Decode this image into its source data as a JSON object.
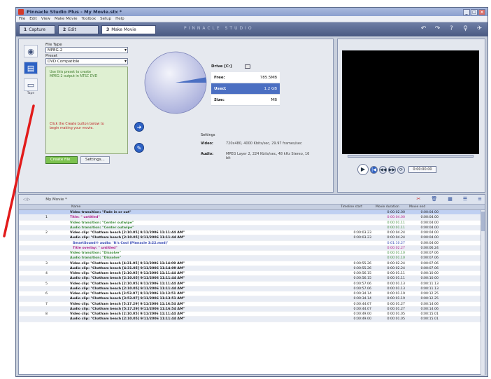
{
  "app": {
    "title": "Pinnacle Studio Plus - My Movie.stx *"
  },
  "menu": [
    "File",
    "Edit",
    "View",
    "Make Movie",
    "Toolbox",
    "Setup",
    "Help"
  ],
  "tabs": [
    {
      "num": "1",
      "label": "Capture"
    },
    {
      "num": "2",
      "label": "Edit"
    },
    {
      "num": "3",
      "label": "Make Movie"
    }
  ],
  "brand": "PINNACLE   STUDIO",
  "left_tools": {
    "disc": "disc-icon",
    "file": "file-icon",
    "tape": "tape-icon",
    "tape_label": "Tape"
  },
  "options": {
    "file_type_label": "File Type",
    "file_type_value": "MPEG-2",
    "preset_label": "Preset",
    "preset_value": "DVD Compatible",
    "tip": "Use this preset to create MPEG-2 output in NTSC DVD",
    "note": "Click the Create button below to begin making your movie.",
    "create_label": "Create file",
    "settings_label": "Settings..."
  },
  "drive": {
    "title": "Drive [C:]",
    "free_label": "Free:",
    "free_value": "785.5MB",
    "used_label": "Used:",
    "used_value": "1.2 GB",
    "size_label": "Size:",
    "size_value": "MB"
  },
  "settings": {
    "head": "Settings",
    "video_label": "Video:",
    "video_value": "720x480, 4000 Kbits/sec, 29.97 frames/sec",
    "audio_label": "Audio:",
    "audio_value": "MPEG Layer 2, 224 Kbits/sec, 48 kHz Stereo, 16 bit"
  },
  "preview": {
    "counter": "0:00:00.00"
  },
  "list": {
    "movie_label": "My Movie *",
    "headers": [
      "Name",
      "Timeline start",
      "Movie duration",
      "Movie end"
    ],
    "rows": [
      {
        "num": "",
        "name": "Video transition: \"Fade in or out\"",
        "start": "",
        "dur": "0:00:02.00",
        "end": "0:00:04.00",
        "style": "sel"
      },
      {
        "num": "1",
        "name": "Title: \" untitled\"",
        "start": "",
        "dur": "0:00:04.00",
        "end": "0:00:04.00",
        "style": "pink"
      },
      {
        "num": "",
        "name": "Video transition: \"Center outwipe\"",
        "start": "",
        "dur": "0:00:01.11",
        "end": "0:00:04.00",
        "style": "green"
      },
      {
        "num": "",
        "name": "Audio transition: \"Center outwipe\"",
        "start": "",
        "dur": "0:00:01.11",
        "end": "0:00:04.00",
        "style": "green"
      },
      {
        "num": "2",
        "name": "Video clip: \"Chatham beach [2:10.05]  9/11/2006 11:11:44 AM\"",
        "start": "0:00:03.23",
        "dur": "0:00:04.24",
        "end": "0:00:04.00",
        "style": ""
      },
      {
        "num": "",
        "name": "Audio clip: \"Chatham beach [2:10.05]  9/11/2006 11:11:44 AM\"",
        "start": "0:00:03.23",
        "dur": "0:00:04.24",
        "end": "0:00:04.00",
        "style": ""
      },
      {
        "num": "",
        "name": "SmartSound® audio: 'It's Cool (Pinnacle 3:22.mod)'",
        "start": "",
        "dur": "0:01:10.27",
        "end": "0:00:04.00",
        "style": "blue"
      },
      {
        "num": "",
        "name": "Title overlay: \" untitled\"",
        "start": "",
        "dur": "0:00:02.27",
        "end": "0:00:06.24",
        "style": "pink indent"
      },
      {
        "num": "",
        "name": "Video transition: \"Dissolve\"",
        "start": "",
        "dur": "0:00:01.10",
        "end": "0:00:07.06",
        "style": "green"
      },
      {
        "num": "",
        "name": "Audio transition: \"Dissolve\"",
        "start": "",
        "dur": "0:00:01.10",
        "end": "0:00:07.06",
        "style": "green"
      },
      {
        "num": "3",
        "name": "Video clip: \"Chatham beach [4:31.05]  9/11/2006 11:14:09 AM\"",
        "start": "0:00:55.26",
        "dur": "0:00:02.24",
        "end": "0:00:07.06",
        "style": ""
      },
      {
        "num": "",
        "name": "Audio clip: \"Chatham beach [4:31.05]  9/11/2006 11:14:09 AM\"",
        "start": "0:00:55.26",
        "dur": "0:00:02.24",
        "end": "0:00:07.06",
        "style": ""
      },
      {
        "num": "4",
        "name": "Video clip: \"Chatham beach [2:10.05]  9/11/2006 11:11:44 AM\"",
        "start": "0:00:56.15",
        "dur": "0:00:01.11",
        "end": "0:00:10.00",
        "style": ""
      },
      {
        "num": "",
        "name": "Audio clip: \"Chatham beach [2:10.05]  9/11/2006 11:11:44 AM\"",
        "start": "0:00:56.15",
        "dur": "0:00:01.11",
        "end": "0:00:10.00",
        "style": ""
      },
      {
        "num": "5",
        "name": "Video clip: \"Chatham beach [2:10.05]  9/11/2006 11:11:44 AM\"",
        "start": "0:00:57.06",
        "dur": "0:00:01.13",
        "end": "0:00:11.13",
        "style": ""
      },
      {
        "num": "",
        "name": "Audio clip: \"Chatham beach [2:10.05]  9/11/2006 11:11:44 AM\"",
        "start": "0:00:57.06",
        "dur": "0:00:01.13",
        "end": "0:00:11.13",
        "style": ""
      },
      {
        "num": "6",
        "name": "Video clip: \"Chatham beach [3:53.07]  9/11/2006 11:13:51 AM\"",
        "start": "0:00:34.14",
        "dur": "0:00:01.19",
        "end": "0:00:12.25",
        "style": ""
      },
      {
        "num": "",
        "name": "Audio clip: \"Chatham beach [3:53.07]  9/11/2006 11:13:51 AM\"",
        "start": "0:00:34.14",
        "dur": "0:00:01.19",
        "end": "0:00:12.25",
        "style": ""
      },
      {
        "num": "7",
        "name": "Video clip: \"Chatham beach [5:17.29]  9/11/2006 11:16:54 AM\"",
        "start": "0:00:44.07",
        "dur": "0:00:01.27",
        "end": "0:00:14.06",
        "style": ""
      },
      {
        "num": "",
        "name": "Audio clip: \"Chatham beach [5:17.29]  9/11/2006 11:16:54 AM\"",
        "start": "0:00:44.07",
        "dur": "0:00:01.27",
        "end": "0:00:14.06",
        "style": ""
      },
      {
        "num": "8",
        "name": "Video clip: \"Chatham beach [2:10.05]  9/11/2006 11:11:44 AM\"",
        "start": "0:00:49.00",
        "dur": "0:00:01.05",
        "end": "0:00:15.01",
        "style": ""
      },
      {
        "num": "",
        "name": "Audio clip: \"Chatham beach [2:10.05]  9/11/2006 11:11:44 AM\"",
        "start": "0:00:49.00",
        "dur": "0:00:01.05",
        "end": "0:00:15.01",
        "style": ""
      }
    ]
  },
  "colors": {
    "accent": "#2e62c5",
    "annotation_arrow": "#e21b1b",
    "used_slice": "#4b6fc2"
  }
}
